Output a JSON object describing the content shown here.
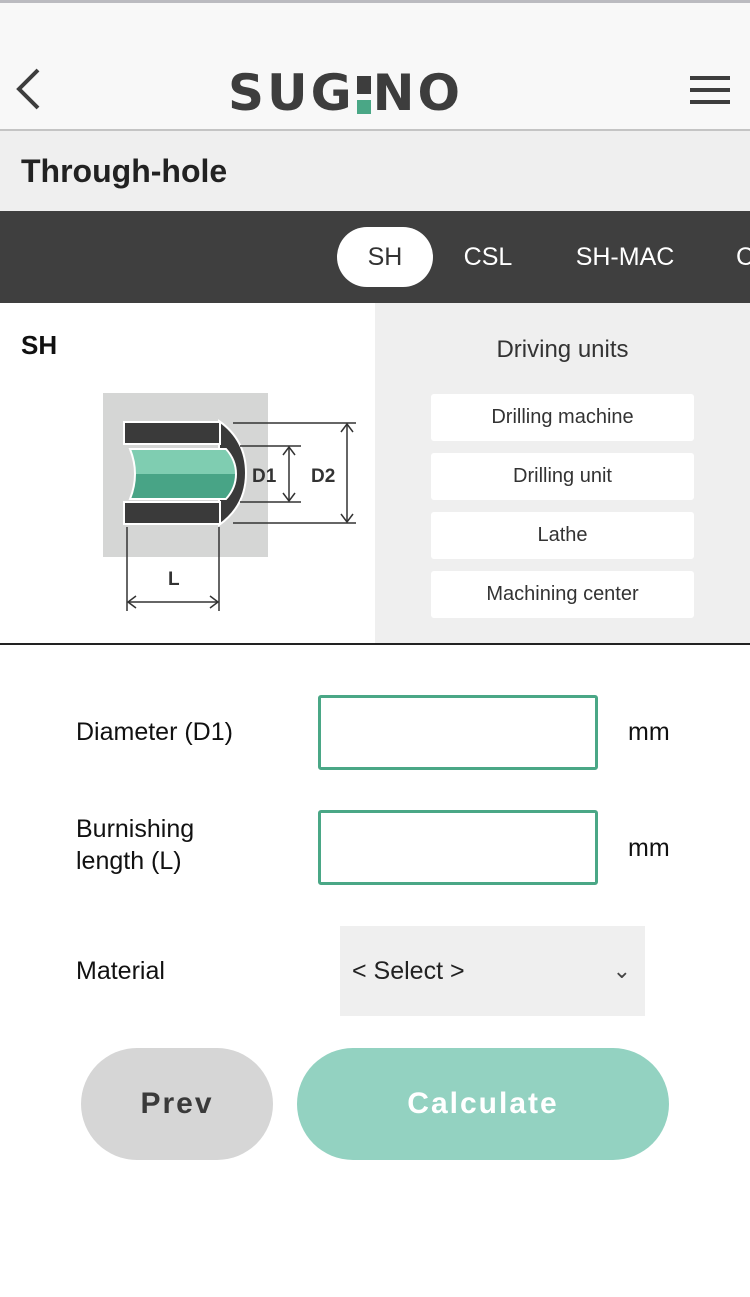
{
  "header": {
    "logo": "SUGINO",
    "back_icon": "chevron-left-icon",
    "menu_icon": "hamburger-icon",
    "logo_accent": "#4aa786"
  },
  "page_title": "Through-hole",
  "tabs": [
    {
      "label": "SH",
      "active": true
    },
    {
      "label": "CSL"
    },
    {
      "label": "SH-MAC"
    },
    {
      "label": "C"
    }
  ],
  "tool": {
    "name": "SH",
    "diagram_labels": {
      "d1": "D1",
      "d2": "D2",
      "l": "L"
    }
  },
  "driving_units": {
    "heading": "Driving units",
    "items": [
      "Drilling machine",
      "Drilling unit",
      "Lathe",
      "Machining center"
    ]
  },
  "form": {
    "diameter": {
      "label": "Diameter (D1)",
      "value": "",
      "unit": "mm"
    },
    "length": {
      "label_line1": "Burnishing",
      "label_line2": "length (L)",
      "value": "",
      "unit": "mm"
    },
    "material": {
      "label": "Material",
      "selected": "< Select >"
    }
  },
  "buttons": {
    "prev": "Prev",
    "calculate": "Calculate"
  },
  "colors": {
    "accent": "#4aa786",
    "calculate_bg": "#93d2c1",
    "prev_bg": "#d6d6d6",
    "tab_bar": "#3f3f3f"
  }
}
